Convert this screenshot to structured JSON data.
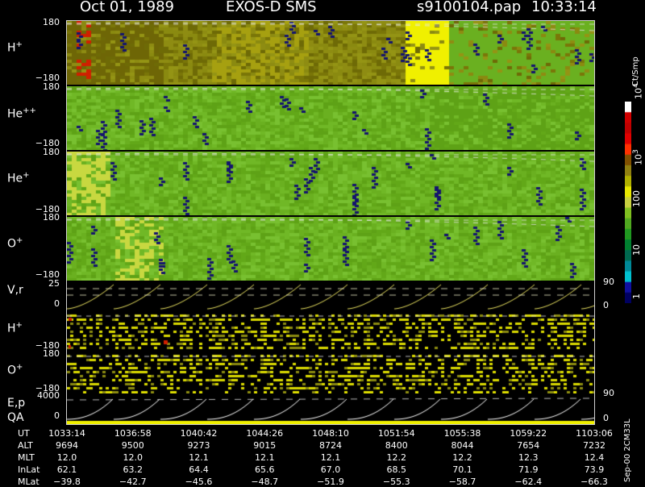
{
  "header": {
    "date": "Oct 01, 1989",
    "instrument": "EXOS-D SMS",
    "file": "s9100104.pap",
    "time": "10:33:14"
  },
  "colors": {
    "background": "#000000",
    "frame": "#d0d0d0",
    "trace_yellow": "#e8e060",
    "trace_white": "#ffffff"
  },
  "panels": [
    {
      "id": "h-plus",
      "ion": "H",
      "charge": "+",
      "ymax": "180",
      "ymin": "−180",
      "dominant": "olive"
    },
    {
      "id": "he-pp",
      "ion": "He",
      "charge": "++",
      "ymax": "180",
      "ymin": "−180",
      "dominant": "green"
    },
    {
      "id": "he-plus",
      "ion": "He",
      "charge": "+",
      "ymax": "180",
      "ymin": "−180",
      "dominant": "green"
    },
    {
      "id": "o-plus",
      "ion": "O",
      "charge": "+",
      "ymax": "180",
      "ymin": "−180",
      "dominant": "green"
    }
  ],
  "vr_panel": {
    "label": "V,r",
    "ymax": "25",
    "ymin": "0",
    "rmax": "90",
    "rmin": "0"
  },
  "h_plus_lower": {
    "ion": "H",
    "charge": "+",
    "ymax": "180",
    "ymin": "−180"
  },
  "o_plus_lower": {
    "ion": "O",
    "charge": "+",
    "ymax": "180",
    "ymin": "−180"
  },
  "ep_panel": {
    "label1": "E,p",
    "label2": "QA",
    "ymax": "4000",
    "ymin": "0",
    "rmax": "90",
    "rmin": "0"
  },
  "colorbar": {
    "unit": "Ct/Smp",
    "ticks": [
      {
        "label": "10",
        "exp": "4"
      },
      {
        "label": "10",
        "exp": "3"
      },
      {
        "label": "100",
        "exp": ""
      },
      {
        "label": "10",
        "exp": ""
      },
      {
        "label": "1",
        "exp": ""
      }
    ]
  },
  "side_note": "Sep-00  2CM33L",
  "chart_data": {
    "type": "heatmap",
    "title": "Oct 01, 1989   EXOS-D SMS",
    "xlabel": "UT",
    "x": [
      "1033:14",
      "1036:58",
      "1040:42",
      "1044:26",
      "1048:10",
      "1051:54",
      "1055:38",
      "1059:22",
      "1103:06"
    ],
    "rows": [
      {
        "name": "ALT",
        "values": [
          "9694",
          "9500",
          "9273",
          "9015",
          "8724",
          "8400",
          "8044",
          "7654",
          "7232"
        ]
      },
      {
        "name": "MLT",
        "values": [
          "12.0",
          "12.0",
          "12.1",
          "12.1",
          "12.1",
          "12.2",
          "12.2",
          "12.3",
          "12.4"
        ]
      },
      {
        "name": "InLat",
        "values": [
          "62.1",
          "63.2",
          "64.4",
          "65.6",
          "67.0",
          "68.5",
          "70.1",
          "71.9",
          "73.9"
        ]
      },
      {
        "name": "MLat",
        "values": [
          "−39.8",
          "−42.7",
          "−45.6",
          "−48.7",
          "−51.9",
          "−55.3",
          "−58.7",
          "−62.4",
          "−66.3"
        ]
      }
    ],
    "ylim": [
      -180,
      180
    ],
    "color_scale": "log",
    "color_range": [
      1,
      10000
    ]
  }
}
